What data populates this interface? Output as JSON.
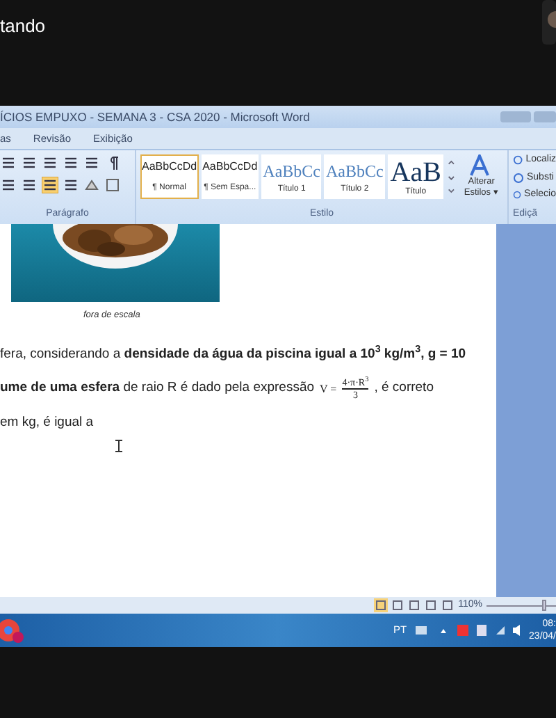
{
  "call": {
    "status_text": "tando"
  },
  "window": {
    "title": "ÍCIOS EMPUXO - SEMANA 3 - CSA 2020 - Microsoft Word"
  },
  "ribbon_tabs": [
    {
      "label": "as",
      "selected": false
    },
    {
      "label": "Revisão",
      "selected": false
    },
    {
      "label": "Exibição",
      "selected": false
    }
  ],
  "align_buttons": [
    {
      "selected": false
    },
    {
      "selected": false
    },
    {
      "selected": true
    }
  ],
  "styles": [
    {
      "preview": "AaBbCcDd",
      "label": "¶ Normal",
      "selected": true,
      "kind": "body"
    },
    {
      "preview": "AaBbCcDd",
      "label": "¶ Sem Espa...",
      "selected": false,
      "kind": "body"
    },
    {
      "preview": "AaBbCc",
      "label": "Título 1",
      "selected": false,
      "kind": "heading"
    },
    {
      "preview": "AaBbCc",
      "label": "Título 2",
      "selected": false,
      "kind": "heading"
    },
    {
      "preview": "AaB",
      "label": "Título",
      "selected": false,
      "kind": "title"
    }
  ],
  "change_styles": {
    "line_1": "Alterar",
    "line_2": "Estilos ▾"
  },
  "edit_items": [
    "Localiz",
    "Substi",
    "Selecio"
  ],
  "group_labels": {
    "paragraph": "Parágrafo",
    "style": "Estilo",
    "edit": "Ediçã"
  },
  "document": {
    "caption": "fora de escala",
    "line_1": "fera, considerando a **densidade da água da piscina igual a 10$^{3}$ kg/m$^{3}$, g = 10**",
    "line_2_start": "**ume de uma esfera** de raio R é dado pela expressão",
    "formula": {
      "lhs": "V =",
      "numerator": "4·π·R$^{3}$",
      "denominator": "3"
    },
    "line_2_end": ", é correto",
    "line_3": "em kg, é igual a"
  },
  "status_bar": {
    "zoom": "110%",
    "zoom_slider": {
      "level": 0.85
    }
  },
  "taskbar": {
    "language": "PT",
    "time": "08:",
    "date": "23/04/"
  }
}
